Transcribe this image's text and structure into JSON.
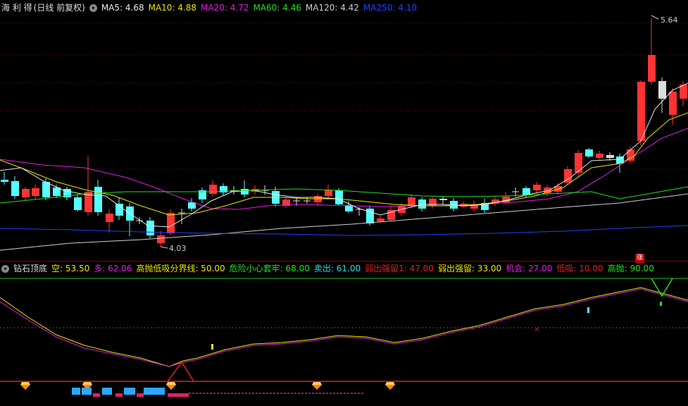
{
  "price": {
    "stock_name": "海 利 得",
    "mode": "(日线 前复权)",
    "ma_items": [
      {
        "label": "MA5: 4.68",
        "color": "#e8e8e8"
      },
      {
        "label": "MA10: 4.88",
        "color": "#e8e800"
      },
      {
        "label": "MA20: 4.72",
        "color": "#e020e0"
      },
      {
        "label": "MA60: 4.46",
        "color": "#20e020"
      },
      {
        "label": "MA120: 4.42",
        "color": "#d0d0d0"
      },
      {
        "label": "MA250: 4.10",
        "color": "#2040ff"
      }
    ],
    "high_label": "5.64",
    "low_label": "4.03",
    "zhang_badge": "涨"
  },
  "indicator": {
    "name": "钻石顶底",
    "items": [
      {
        "label": "空: 53.50",
        "color": "#e8e800"
      },
      {
        "label": "多: 62.06",
        "color": "#e020e0"
      },
      {
        "label": "高抛低吸分界线: 50.00",
        "color": "#e8e800"
      },
      {
        "label": "危险小心套牢: 68.00",
        "color": "#20e020"
      },
      {
        "label": "卖出: 61.00",
        "color": "#20e0e0"
      },
      {
        "label": "弱出强留1: 47.00",
        "color": "#e02020"
      },
      {
        "label": "弱出强留: 33.00",
        "color": "#e8e800"
      },
      {
        "label": "机会: 27.00",
        "color": "#e020e0"
      },
      {
        "label": "低吸: 10.00",
        "color": "#e02020"
      },
      {
        "label": "高抛: 90.00",
        "color": "#20e020"
      }
    ]
  },
  "colors": {
    "up": "#ff3333",
    "down": "#54ffff",
    "bg": "#000000"
  }
}
